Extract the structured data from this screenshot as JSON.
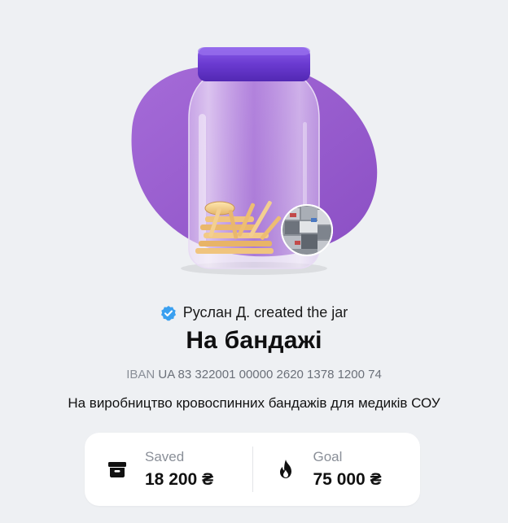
{
  "jar": {
    "creator_text": "Руслан Д. created the jar",
    "title": "На бандажі",
    "iban_label": "IBAN",
    "iban_value": "UA 83 322001 00000 2620 1378 1200 74",
    "description": "На виробництво кровоспинних бандажів для медиків СОУ"
  },
  "stats": {
    "saved_label": "Saved",
    "saved_value": "18 200 ₴",
    "goal_label": "Goal",
    "goal_value": "75 000 ₴"
  },
  "icons": {
    "verified": "verified-badge-icon",
    "saved": "archive-box-icon",
    "goal": "flame-icon"
  },
  "colors": {
    "background": "#eef0f3",
    "blob": "#9b5fcf",
    "jar_lid": "#6f3fd6",
    "verified": "#3aa0f0"
  }
}
